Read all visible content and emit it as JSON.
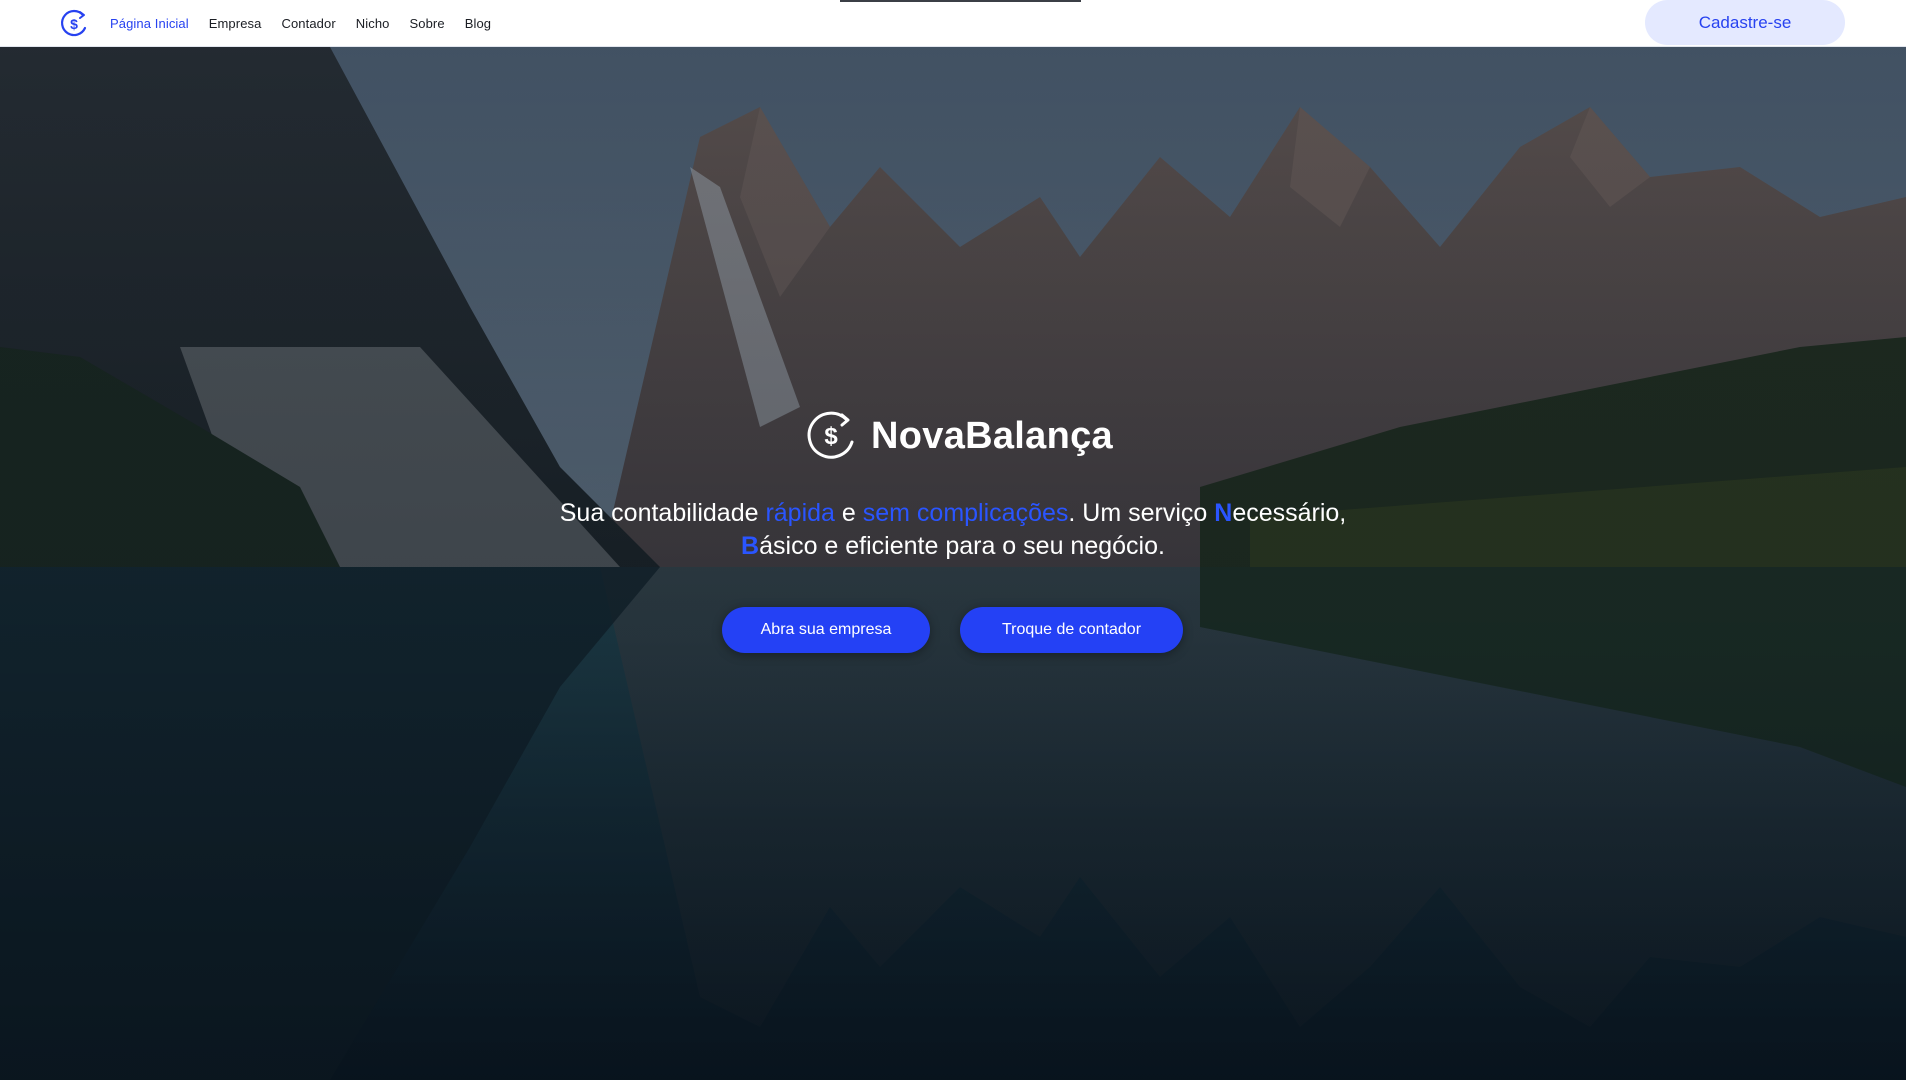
{
  "nav": {
    "logo_icon": "dollar-cycle-icon",
    "links": [
      {
        "label": "Página Inicial",
        "active": true
      },
      {
        "label": "Empresa",
        "active": false
      },
      {
        "label": "Contador",
        "active": false
      },
      {
        "label": "Nicho",
        "active": false
      },
      {
        "label": "Sobre",
        "active": false
      },
      {
        "label": "Blog",
        "active": false
      }
    ],
    "signup_label": "Cadastre-se"
  },
  "hero": {
    "brand_icon": "dollar-cycle-icon",
    "brand_name": "NovaBalança",
    "tagline": {
      "t1": "Sua contabilidade ",
      "h1": "rápida",
      "t2": " e ",
      "h2": "sem complicações",
      "t3": ". Um serviço ",
      "n_letter": "N",
      "t4": "ecessário, ",
      "b_letter": "B",
      "t5": "ásico e eficiente para o seu negócio."
    },
    "buttons": {
      "open_company": "Abra sua empresa",
      "switch_accountant": "Troque de contador"
    }
  },
  "colors": {
    "accent": "#2742f0",
    "highlight": "#2a55ff",
    "signup_bg": "#e4e9ff"
  }
}
